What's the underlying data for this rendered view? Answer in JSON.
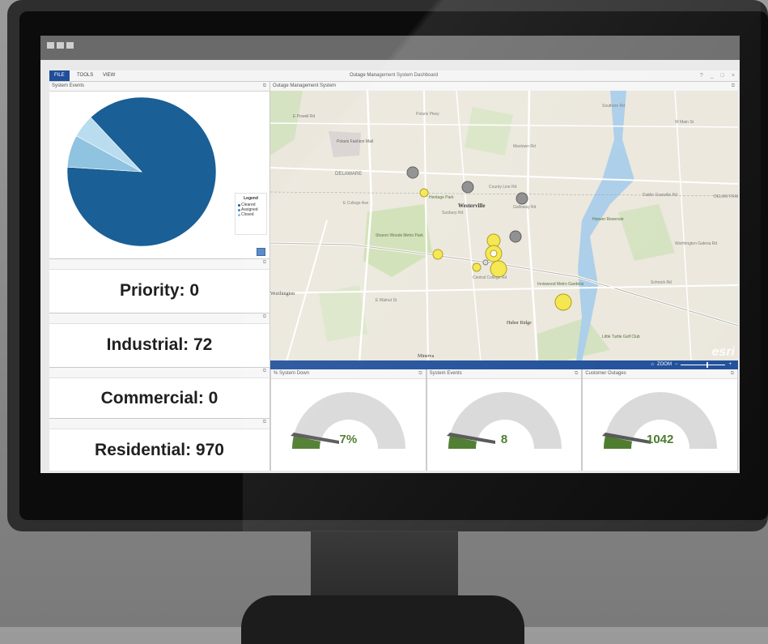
{
  "window": {
    "title": "Outage Management System Dashboard",
    "menu": [
      "FILE",
      "TOOLS",
      "VIEW"
    ],
    "controls": [
      "?",
      "_",
      "□",
      "×"
    ]
  },
  "system_events_panel": {
    "title": "System Events",
    "legend_title": "Legend",
    "legend": [
      {
        "label": "Cleared",
        "color": "#1a5f96"
      },
      {
        "label": "Assigned",
        "color": "#3c86ba"
      },
      {
        "label": "Closed",
        "color": "#7fbde0"
      }
    ],
    "chart_data": {
      "type": "pie",
      "categories": [
        "Cleared",
        "Assigned",
        "Closed"
      ],
      "values": [
        88,
        7,
        5
      ],
      "colors": [
        "#1a5f96",
        "#8fc3df",
        "#b9dcef"
      ]
    }
  },
  "stats": [
    {
      "label": "Priority: 0"
    },
    {
      "label": "Industrial: 72"
    },
    {
      "label": "Commercial: 0"
    },
    {
      "label": "Residential: 970"
    }
  ],
  "map": {
    "title": "Outage Management System",
    "zoom_label": "ZOOM",
    "attribution": "esri",
    "places": [
      "Polaris Fashion Mall",
      "DELAWARE",
      "Westerville",
      "Heritage Park",
      "Sharon Woods Metro Park",
      "Worthington",
      "Huber Ridge",
      "Minerva",
      "Hoover Reservoir",
      "Inniswood Metro Gardens",
      "Little Turtle Golf Club",
      "DELAW FRANK"
    ],
    "roads": [
      "E Powell Rd",
      "Polaris Pkwy",
      "Maxtown Rd",
      "County Line Rd",
      "Schrock Rd",
      "Dublin Granville Rd",
      "Worthington Galena Rd",
      "W Main St",
      "E College Ave",
      "Sunbury Rd",
      "Galloway Rd",
      "Southern Rd",
      "Central College Rd",
      "E Walnut St"
    ]
  },
  "gauges": [
    {
      "title": "% System Down",
      "value_text": "7%"
    },
    {
      "title": "System Events",
      "value_text": "8"
    },
    {
      "title": "Customer Outages",
      "value_text": "1042"
    }
  ]
}
